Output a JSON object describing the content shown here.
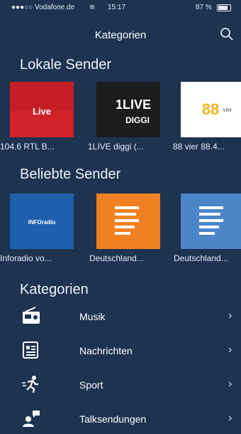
{
  "status": {
    "carrier": "●●●○○ Vodafone.de",
    "time": "15:17",
    "battery": "87 %"
  },
  "nav": {
    "title": "Kategorien",
    "search_icon": "search-icon"
  },
  "sections": {
    "local": "Lokale Sender",
    "popular": "Beliebte Sender",
    "categories": "Kategorien"
  },
  "local_stations": [
    {
      "label": "104.6 RTL B...",
      "logo_text": "Live",
      "color": "#d2222c"
    },
    {
      "label": "1LIVE diggi (...",
      "logo_text": "1LIVE",
      "logo_sub": "DIGGI",
      "color": "#1c1c1c"
    },
    {
      "label": "88 vier 88.4...",
      "logo_text": "88",
      "logo_sub": "vier",
      "color": "#ffffff"
    }
  ],
  "popular_stations": [
    {
      "label": "Inforadio vo...",
      "logo_text": "INFOradio",
      "color": "#1f61ad"
    },
    {
      "label": "Deutschland...",
      "color": "#f08122"
    },
    {
      "label": "Deutschland...",
      "color": "#4b86c8"
    }
  ],
  "categories": [
    {
      "label": "Musik",
      "icon": "radio-icon"
    },
    {
      "label": "Nachrichten",
      "icon": "newspaper-icon"
    },
    {
      "label": "Sport",
      "icon": "runner-icon"
    },
    {
      "label": "Talksendungen",
      "icon": "talk-icon"
    }
  ],
  "colors": {
    "background": "#1d3350",
    "text": "#ffffff"
  }
}
